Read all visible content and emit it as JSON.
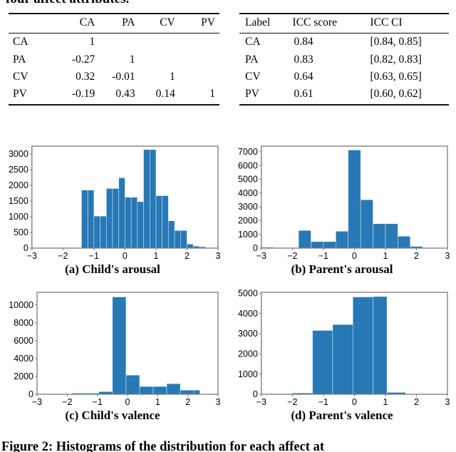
{
  "page": {
    "top_partial_heading": "four affect attributes.",
    "bottom_partial_caption": "Figure 2: Histograms of the distribution for each affect at"
  },
  "colors": {
    "bar_fill": "#2878b5",
    "axis": "#808080",
    "text": "#000000",
    "rule": "#111111"
  },
  "table_correlation": {
    "name": "affect-attribute-correlation-table",
    "headers": [
      "",
      "CA",
      "PA",
      "CV",
      "PV"
    ],
    "rows": [
      {
        "label": "CA",
        "values": [
          "1",
          "",
          "",
          ""
        ]
      },
      {
        "label": "PA",
        "values": [
          "-0.27",
          "1",
          "",
          ""
        ]
      },
      {
        "label": "CV",
        "values": [
          "0.32",
          "-0.01",
          "1",
          ""
        ]
      },
      {
        "label": "PV",
        "values": [
          "-0.19",
          "0.43",
          "0.14",
          "1"
        ]
      }
    ]
  },
  "table_icc": {
    "name": "icc-score-table",
    "headers": [
      "Label",
      "ICC score",
      "ICC CI"
    ],
    "rows": [
      {
        "label": "CA",
        "score": "0.84",
        "ci": "[0.84, 0.85]"
      },
      {
        "label": "PA",
        "score": "0.83",
        "ci": "[0.82, 0.83]"
      },
      {
        "label": "CV",
        "score": "0.64",
        "ci": "[0.63, 0.65]"
      },
      {
        "label": "PV",
        "score": "0.61",
        "ci": "[0.60, 0.62]"
      }
    ]
  },
  "chart_data": [
    {
      "id": "a",
      "type": "bar",
      "title": "(a) Child's arousal",
      "xlabel": "",
      "ylabel": "",
      "xlim": [
        -3,
        3
      ],
      "ylim": [
        0,
        3250
      ],
      "xticks": [
        -3,
        -2,
        -1,
        0,
        1,
        2,
        3
      ],
      "xticklabels": [
        "−3",
        "−2",
        "−1",
        "0",
        "1",
        "2",
        "3"
      ],
      "yticks": [
        0,
        500,
        1000,
        1500,
        2000,
        2500,
        3000
      ],
      "yticklabels": [
        "0",
        "500",
        "1000",
        "1500",
        "2000",
        "2500",
        "3000"
      ],
      "grid": false,
      "legend": "none",
      "bin_edges": [
        -1.4,
        -1.2,
        -1.0,
        -0.8,
        -0.6,
        -0.4,
        -0.2,
        0.0,
        0.2,
        0.4,
        0.6,
        0.8,
        1.0,
        1.2,
        1.4,
        1.6,
        1.8,
        2.0,
        2.2,
        2.4,
        2.6
      ],
      "values": [
        1850,
        1850,
        1020,
        1020,
        1900,
        1900,
        2240,
        1620,
        1620,
        1480,
        3140,
        3140,
        1670,
        1670,
        870,
        560,
        560,
        130,
        60,
        40
      ]
    },
    {
      "id": "b",
      "type": "bar",
      "title": "(b) Parent's arousal",
      "xlabel": "",
      "ylabel": "",
      "xlim": [
        -3,
        3
      ],
      "ylim": [
        0,
        7400
      ],
      "xticks": [
        -3,
        -2,
        -1,
        0,
        1,
        2,
        3
      ],
      "xticklabels": [
        "−3",
        "−2",
        "−1",
        "0",
        "1",
        "2",
        "3"
      ],
      "yticks": [
        0,
        1000,
        2000,
        3000,
        4000,
        5000,
        6000,
        7000
      ],
      "yticklabels": [
        "0",
        "1000",
        "2000",
        "3000",
        "4000",
        "5000",
        "6000",
        "7000"
      ],
      "grid": false,
      "legend": "none",
      "bin_edges": [
        -3.0,
        -2.6,
        -2.2,
        -1.8,
        -1.4,
        -1.0,
        -0.6,
        -0.2,
        0.2,
        0.6,
        1.0,
        1.4,
        1.8,
        2.2,
        2.6,
        3.0
      ],
      "values": [
        60,
        30,
        40,
        1280,
        470,
        470,
        1220,
        7120,
        3510,
        1770,
        1770,
        860,
        120,
        40,
        20
      ]
    },
    {
      "id": "c",
      "type": "bar",
      "title": "(c) Child's valence",
      "xlabel": "",
      "ylabel": "",
      "xlim": [
        -3,
        3
      ],
      "ylim": [
        0,
        11400
      ],
      "xticks": [
        -3,
        -2,
        -1,
        0,
        1,
        2,
        3
      ],
      "xticklabels": [
        "−3",
        "−2",
        "−1",
        "0",
        "1",
        "2",
        "3"
      ],
      "yticks": [
        0,
        2000,
        4000,
        6000,
        8000,
        10000
      ],
      "yticklabels": [
        "0",
        "2000",
        "4000",
        "6000",
        "8000",
        "10000"
      ],
      "grid": false,
      "legend": "none",
      "bin_edges": [
        -2.3,
        -1.85,
        -1.4,
        -0.95,
        -0.5,
        -0.05,
        0.4,
        0.85,
        1.3,
        1.75,
        2.2,
        2.4
      ],
      "values": [
        30,
        120,
        120,
        290,
        10880,
        2140,
        870,
        870,
        1180,
        460,
        460
      ]
    },
    {
      "id": "d",
      "type": "bar",
      "title": "(d) Parent's valence",
      "xlabel": "",
      "ylabel": "",
      "xlim": [
        -3,
        3
      ],
      "ylim": [
        0,
        5050
      ],
      "xticks": [
        -3,
        -2,
        -1,
        0,
        1,
        2,
        3
      ],
      "xticklabels": [
        "−3",
        "−2",
        "−1",
        "0",
        "1",
        "2",
        "3"
      ],
      "yticks": [
        0,
        1000,
        2000,
        3000,
        4000,
        5000
      ],
      "yticklabels": [
        "0",
        "1000",
        "2000",
        "3000",
        "4000",
        "5000"
      ],
      "grid": false,
      "legend": "none",
      "bin_edges": [
        -2.0,
        -1.35,
        -0.7,
        -0.05,
        0.6,
        1.05,
        1.65
      ],
      "values": [
        60,
        3160,
        3450,
        4820,
        4840,
        90
      ]
    }
  ]
}
